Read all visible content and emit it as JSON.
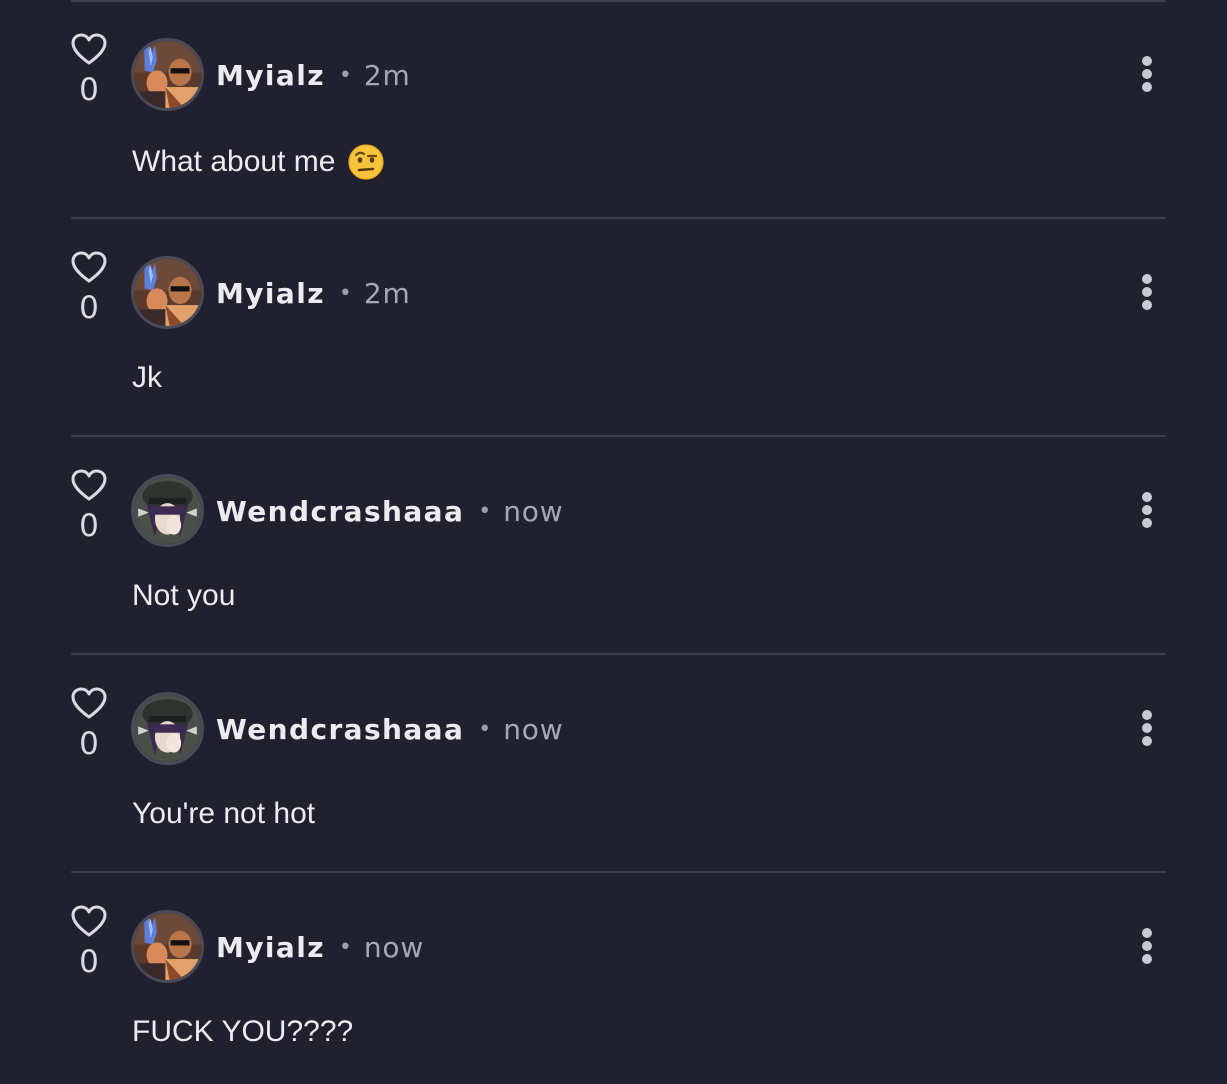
{
  "comments": [
    {
      "likes": "0",
      "username": "Myialz",
      "separator": "•",
      "time": "2m",
      "text": "What about me",
      "emoji": "face-with-raised-eyebrow-emoji",
      "avatar": "myialz-avatar"
    },
    {
      "likes": "0",
      "username": "Myialz",
      "separator": "•",
      "time": "2m",
      "text": "Jk",
      "avatar": "myialz-avatar"
    },
    {
      "likes": "0",
      "username": "Wendcrashaaa",
      "separator": "•",
      "time": "now",
      "text": "Not you",
      "avatar": "wendcrashaaa-avatar"
    },
    {
      "likes": "0",
      "username": "Wendcrashaaa",
      "separator": "•",
      "time": "now",
      "text": "You're not hot",
      "avatar": "wendcrashaaa-avatar"
    },
    {
      "likes": "0",
      "username": "Myialz",
      "separator": "•",
      "time": "now",
      "text": "FUCK YOU????",
      "avatar": "myialz-avatar"
    }
  ],
  "icons": {
    "like": "heart-outline-icon",
    "menu": "more-vertical-icon"
  },
  "colors": {
    "background": "#20202f",
    "divider": "#3c3c4a",
    "text": "#ececf0",
    "muted": "#a6a6b4"
  }
}
